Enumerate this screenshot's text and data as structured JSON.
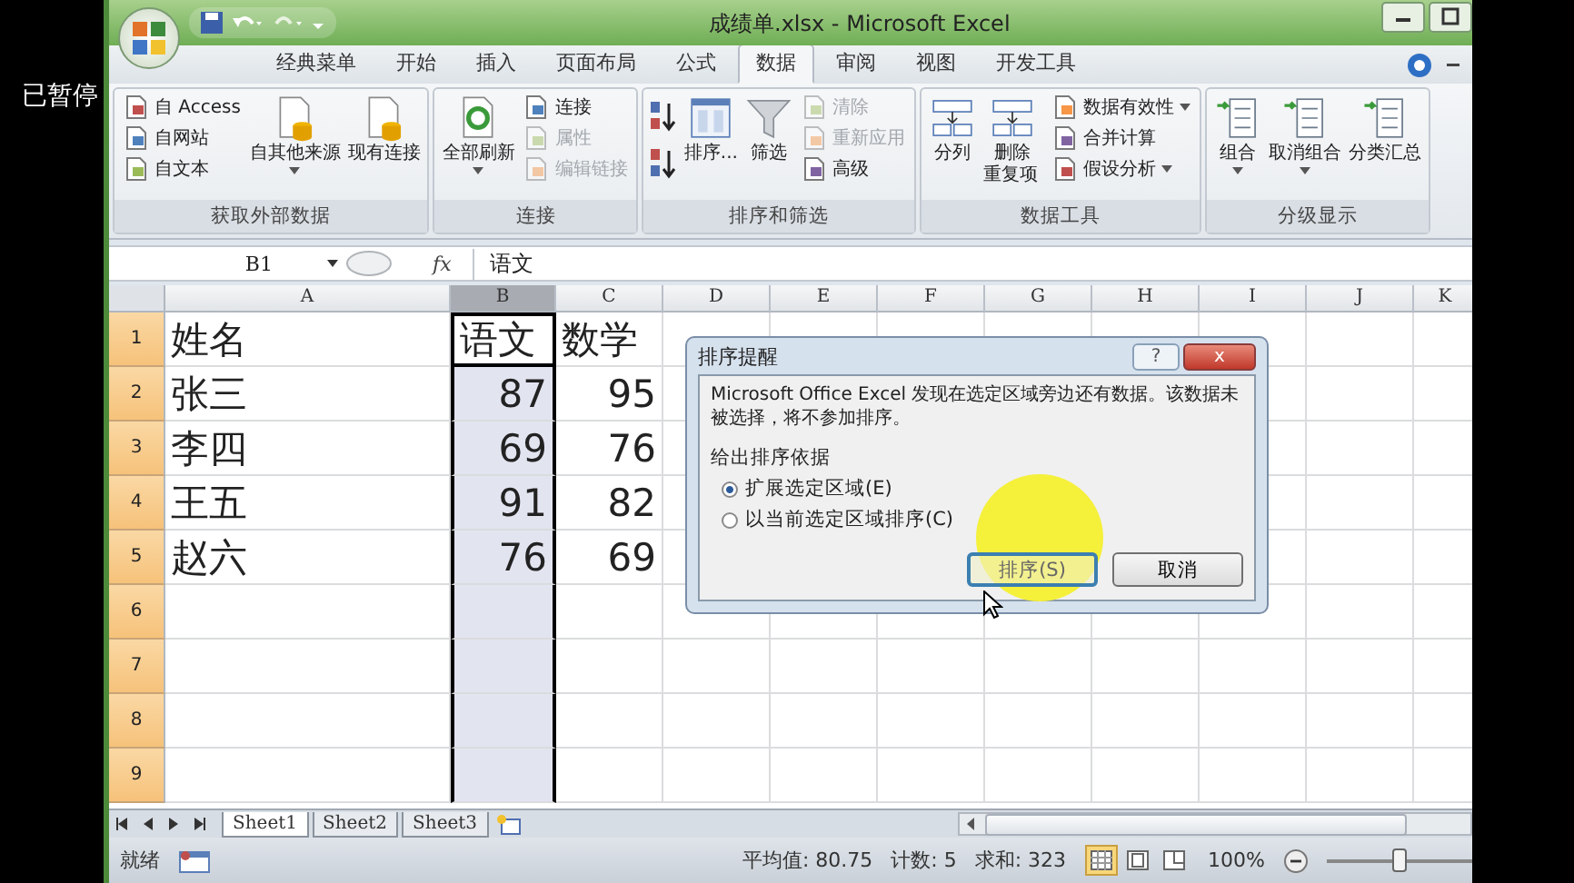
{
  "player_status": "已暂停",
  "window": {
    "title": "成绩单.xlsx - Microsoft Excel"
  },
  "tabs": [
    {
      "label": "经典菜单",
      "selected": false
    },
    {
      "label": "开始",
      "selected": false
    },
    {
      "label": "插入",
      "selected": false
    },
    {
      "label": "页面布局",
      "selected": false
    },
    {
      "label": "公式",
      "selected": false
    },
    {
      "label": "数据",
      "selected": true
    },
    {
      "label": "审阅",
      "selected": false
    },
    {
      "label": "视图",
      "selected": false
    },
    {
      "label": "开发工具",
      "selected": false
    }
  ],
  "ribbon": {
    "groups": [
      {
        "label": "获取外部数据",
        "columns": [
          {
            "kind": "stack",
            "items": [
              {
                "label": "自 Access",
                "disabled": false,
                "dropdown": false
              },
              {
                "label": "自网站",
                "disabled": false,
                "dropdown": false
              },
              {
                "label": "自文本",
                "disabled": false,
                "dropdown": false
              }
            ]
          },
          {
            "kind": "large",
            "label": "自其他来源",
            "dropdown": true
          },
          {
            "kind": "large",
            "label": "现有连接",
            "dropdown": false
          }
        ]
      },
      {
        "label": "连接",
        "columns": [
          {
            "kind": "large",
            "label": "全部刷新",
            "dropdown": true
          },
          {
            "kind": "stack",
            "items": [
              {
                "label": "连接",
                "disabled": false,
                "dropdown": false
              },
              {
                "label": "属性",
                "disabled": true,
                "dropdown": false
              },
              {
                "label": "编辑链接",
                "disabled": true,
                "dropdown": false
              }
            ]
          }
        ]
      },
      {
        "label": "排序和筛选",
        "columns": [
          {
            "kind": "sort-pair"
          },
          {
            "kind": "large",
            "label": "排序...",
            "dropdown": false
          },
          {
            "kind": "large",
            "label": "筛选",
            "dropdown": false
          },
          {
            "kind": "stack",
            "items": [
              {
                "label": "清除",
                "disabled": true,
                "dropdown": false
              },
              {
                "label": "重新应用",
                "disabled": true,
                "dropdown": false
              },
              {
                "label": "高级",
                "disabled": false,
                "dropdown": false
              }
            ]
          }
        ]
      },
      {
        "label": "数据工具",
        "columns": [
          {
            "kind": "large",
            "label": "分列",
            "dropdown": false
          },
          {
            "kind": "large-wrapped",
            "label": "删除重复项",
            "dropdown": false
          },
          {
            "kind": "stack",
            "items": [
              {
                "label": "数据有效性",
                "disabled": false,
                "dropdown": true
              },
              {
                "label": "合并计算",
                "disabled": false,
                "dropdown": false
              },
              {
                "label": "假设分析",
                "disabled": false,
                "dropdown": true
              }
            ]
          }
        ]
      },
      {
        "label": "分级显示",
        "columns": [
          {
            "kind": "large",
            "label": "组合",
            "dropdown": true
          },
          {
            "kind": "large",
            "label": "取消组合",
            "dropdown": true
          },
          {
            "kind": "large",
            "label": "分类汇总",
            "dropdown": false
          }
        ]
      }
    ]
  },
  "formula_bar": {
    "name_box": "B1",
    "fx": "fx",
    "value": "语文"
  },
  "columns": [
    {
      "label": "A",
      "selected": false
    },
    {
      "label": "B",
      "selected": true
    },
    {
      "label": "C",
      "selected": false
    },
    {
      "label": "D",
      "selected": false
    },
    {
      "label": "E",
      "selected": false
    },
    {
      "label": "F",
      "selected": false
    },
    {
      "label": "G",
      "selected": false
    },
    {
      "label": "H",
      "selected": false
    },
    {
      "label": "I",
      "selected": false
    },
    {
      "label": "J",
      "selected": false
    },
    {
      "label": "K",
      "selected": false
    }
  ],
  "rows": [
    {
      "header": "1",
      "selected": true,
      "cells": [
        {
          "text": "姓名",
          "kind": "text"
        },
        {
          "text": "语文",
          "kind": "text"
        },
        {
          "text": "数学",
          "kind": "text"
        }
      ]
    },
    {
      "header": "2",
      "selected": true,
      "cells": [
        {
          "text": "张三",
          "kind": "text"
        },
        {
          "text": "87",
          "kind": "number"
        },
        {
          "text": "95",
          "kind": "number"
        }
      ]
    },
    {
      "header": "3",
      "selected": true,
      "cells": [
        {
          "text": "李四",
          "kind": "text"
        },
        {
          "text": "69",
          "kind": "number"
        },
        {
          "text": "76",
          "kind": "number"
        }
      ]
    },
    {
      "header": "4",
      "selected": true,
      "cells": [
        {
          "text": "王五",
          "kind": "text"
        },
        {
          "text": "91",
          "kind": "number"
        },
        {
          "text": "82",
          "kind": "number"
        }
      ]
    },
    {
      "header": "5",
      "selected": true,
      "cells": [
        {
          "text": "赵六",
          "kind": "text"
        },
        {
          "text": "76",
          "kind": "number"
        },
        {
          "text": "69",
          "kind": "number"
        }
      ]
    },
    {
      "header": "6",
      "selected": true,
      "cells": []
    },
    {
      "header": "7",
      "selected": true,
      "cells": []
    },
    {
      "header": "8",
      "selected": true,
      "cells": []
    },
    {
      "header": "9",
      "selected": true,
      "cells": []
    }
  ],
  "dialog": {
    "title": "排序提醒",
    "help": "?",
    "close": "x",
    "message": "Microsoft Office Excel 发现在选定区域旁边还有数据。该数据未被选择，将不参加排序。",
    "group_label": "给出排序依据",
    "options": [
      {
        "label": "扩展选定区域(E)",
        "selected": true
      },
      {
        "label": "以当前选定区域排序(C)",
        "selected": false
      }
    ],
    "buttons": [
      {
        "label": "排序(S)",
        "focused": true
      },
      {
        "label": "取消",
        "focused": false
      }
    ]
  },
  "sheets": [
    {
      "label": "Sheet1",
      "selected": true
    },
    {
      "label": "Sheet2",
      "selected": false
    },
    {
      "label": "Sheet3",
      "selected": false
    }
  ],
  "status_bar": {
    "mode": "就绪",
    "average": "平均值: 80.75",
    "count": "计数: 5",
    "sum": "求和: 323",
    "views": [
      {
        "selected": true
      },
      {
        "selected": false
      },
      {
        "selected": false
      }
    ],
    "zoom": "100%",
    "zoom_slider": {
      "level": 0.5
    }
  }
}
